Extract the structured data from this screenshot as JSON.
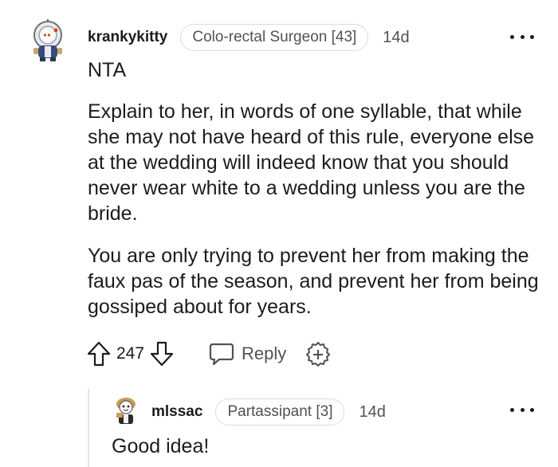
{
  "comment": {
    "username": "krankykitty",
    "flair": "Colo-rectal Surgeon [43]",
    "timestamp": "14d",
    "paragraphs": [
      "NTA",
      "Explain to her, in words of one syllable, that while she may not have heard of this rule, everyone else at the wedding will indeed know that you should never wear white to a wedding unless you are the bride.",
      "You are only trying to prevent her from making the faux pas of the season, and prevent her from being gossiped about for years."
    ],
    "vote_count": "247",
    "reply_label": "Reply"
  },
  "reply": {
    "username": "mlssac",
    "flair": "Partassipant [3]",
    "timestamp": "14d",
    "text": "Good idea!"
  },
  "colors": {
    "text": "#1c1c1c",
    "muted": "#4f5356",
    "border": "#d9dcde",
    "avatar_orange": "#d94a12"
  },
  "icons": [
    "snoo-avatar",
    "upvote-icon",
    "downvote-icon",
    "comment-bubble-icon",
    "award-plus-icon",
    "more-options-icon"
  ]
}
